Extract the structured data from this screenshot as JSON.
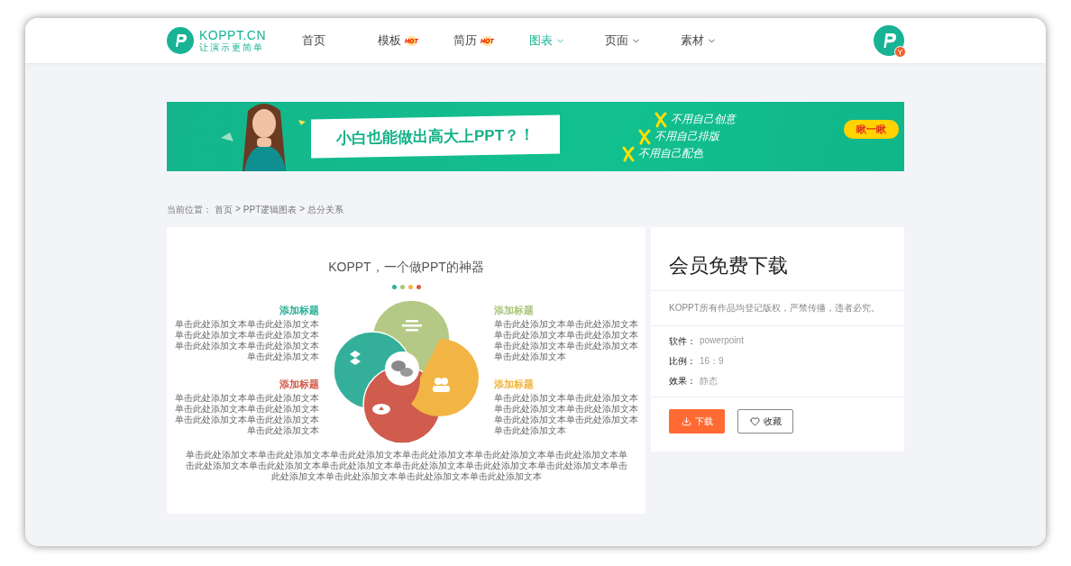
{
  "header": {
    "logo": {
      "name": "KOPPT.CN",
      "tagline": "让演示更简单"
    },
    "nav": [
      {
        "label": "首页",
        "kind": "plain",
        "selected": false
      },
      {
        "label": "模板",
        "kind": "hot",
        "badge": "HOT",
        "selected": false
      },
      {
        "label": "简历",
        "kind": "hot",
        "badge": "HOT",
        "selected": false
      },
      {
        "label": "图表",
        "kind": "dropdown",
        "selected": true
      },
      {
        "label": "页面",
        "kind": "dropdown",
        "selected": false
      },
      {
        "label": "素材",
        "kind": "dropdown",
        "selected": false
      }
    ]
  },
  "banner": {
    "headline": "小白也能做出高大上PPT？！",
    "points": [
      "不用自己创意",
      "不用自己排版",
      "不用自己配色"
    ],
    "button": "瞅一瞅"
  },
  "breadcrumb": {
    "label": "当前位置：",
    "separator": ">",
    "items": [
      "首页",
      "PPT逻辑图表",
      "总分关系"
    ]
  },
  "preview": {
    "title": "KOPPT，一个做PPT的神器",
    "dots": [
      {
        "color": "#2bb09a"
      },
      {
        "color": "#a9c57c"
      },
      {
        "color": "#f0b341"
      },
      {
        "color": "#d35a4a"
      }
    ],
    "sections": [
      {
        "heading": "添加标题",
        "color": "#2bb09a",
        "body": "单击此处添加文本单击此处添加文本单击此处添加文本单击此处添加文本单击此处添加文本单击此处添加文本单击此处添加文本"
      },
      {
        "heading": "添加标题",
        "color": "#a9c57c",
        "body": "单击此处添加文本单击此处添加文本单击此处添加文本单击此处添加文本单击此处添加文本单击此处添加文本单击此处添加文本"
      },
      {
        "heading": "添加标题",
        "color": "#d35a4a",
        "body": "单击此处添加文本单击此处添加文本单击此处添加文本单击此处添加文本单击此处添加文本单击此处添加文本单击此处添加文本"
      },
      {
        "heading": "添加标题",
        "color": "#f0b341",
        "body": "单击此处添加文本单击此处添加文本单击此处添加文本单击此处添加文本单击此处添加文本单击此处添加文本单击此处添加文本"
      }
    ],
    "footer_text": "单击此处添加文本单击此处添加文本单击此处添加文本单击此处添加文本单击此处添加文本单击此处添加文本单击此处添加文本单击此处添加文本单击此处添加文本单击此处添加文本单击此处添加文本单击此处添加文本单击此处添加文本单击此处添加文本单击此处添加文本单击此处添加文本"
  },
  "download": {
    "title": "会员免费下载",
    "notice": "KOPPT所有作品均登记版权，严禁传播，违者必究。",
    "specs": [
      {
        "label": "软件：",
        "value": "powerpoint"
      },
      {
        "label": "比例：",
        "value": "16：9"
      },
      {
        "label": "效果：",
        "value": "静态"
      }
    ],
    "buttons": [
      {
        "label": "下载",
        "kind": "primary"
      },
      {
        "label": "收藏",
        "kind": "outline"
      }
    ]
  }
}
